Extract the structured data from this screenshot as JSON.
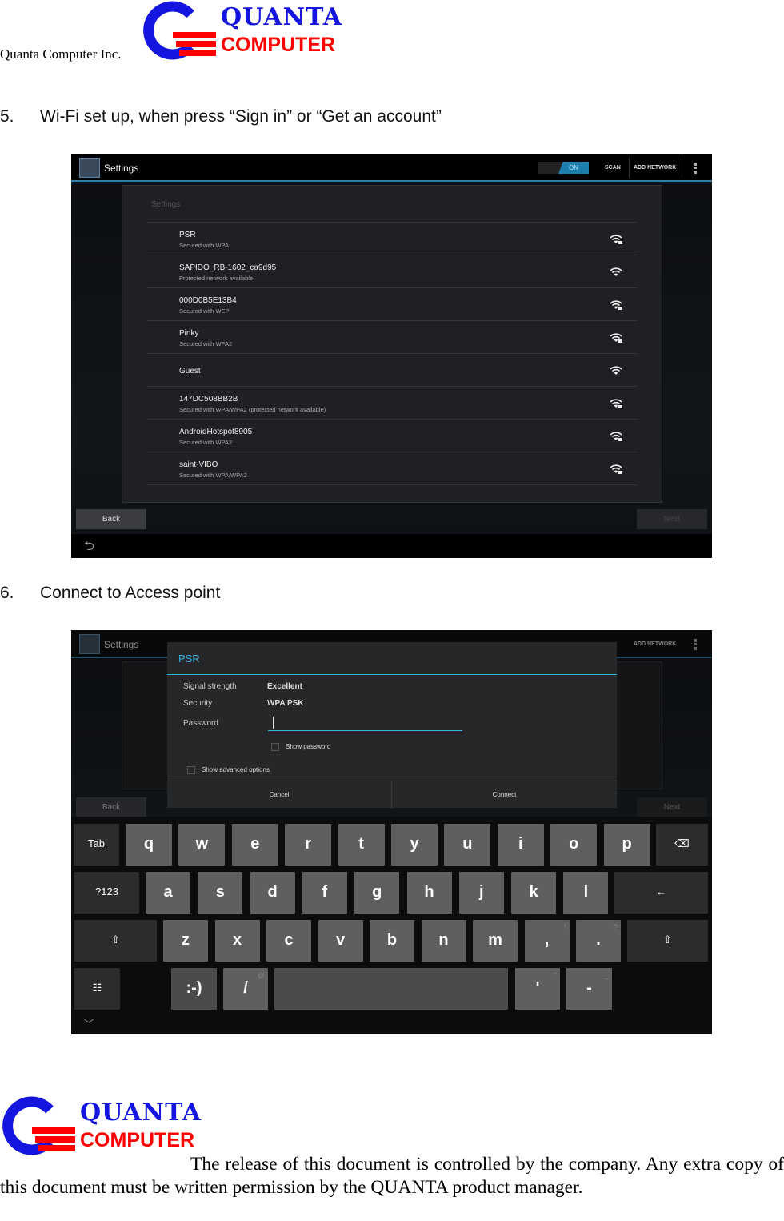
{
  "header": {
    "company": "Quanta Computer Inc.",
    "logo_line1": "QUANTA",
    "logo_line2": "COMPUTER"
  },
  "section5": {
    "number": "5.",
    "title": "Wi-Fi set up, when press “Sign in” or “Get an account”"
  },
  "section6": {
    "number": "6.",
    "title": "Connect to Access point"
  },
  "screen1": {
    "app_title": "Settings",
    "toggle": "ON",
    "scan": "SCAN",
    "add_network": "ADD NETWORK",
    "panel_header": "Settings",
    "networks": [
      {
        "name": "PSR",
        "status": "Secured with WPA",
        "locked": true
      },
      {
        "name": "SAPIDO_RB-1602_ca9d95",
        "status": "Protected network available",
        "locked": false
      },
      {
        "name": "000D0B5E13B4",
        "status": "Secured with WEP",
        "locked": true
      },
      {
        "name": "Pinky",
        "status": "Secured with WPA2",
        "locked": true
      },
      {
        "name": "Guest",
        "status": "",
        "locked": false
      },
      {
        "name": "147DC508BB2B",
        "status": "Secured with WPA/WPA2 (protected network available)",
        "locked": true
      },
      {
        "name": "AndroidHotspot8905",
        "status": "Secured with WPA2",
        "locked": true
      },
      {
        "name": "saint-VIBO",
        "status": "Secured with WPA/WPA2",
        "locked": true
      }
    ],
    "back": "Back",
    "next": "Next"
  },
  "screen2": {
    "app_title": "Settings",
    "add_network": "ADD NETWORK",
    "back": "Back",
    "next": "Next",
    "dialog": {
      "title": "PSR",
      "signal_label": "Signal strength",
      "signal_value": "Excellent",
      "security_label": "Security",
      "security_value": "WPA PSK",
      "password_label": "Password",
      "password_value": "",
      "show_password": "Show password",
      "show_advanced": "Show advanced options",
      "cancel": "Cancel",
      "connect": "Connect"
    },
    "keyboard": {
      "rows": [
        [
          {
            "k": "Tab",
            "fn": true
          },
          {
            "k": "q"
          },
          {
            "k": "w"
          },
          {
            "k": "e"
          },
          {
            "k": "r"
          },
          {
            "k": "t"
          },
          {
            "k": "y"
          },
          {
            "k": "u"
          },
          {
            "k": "i"
          },
          {
            "k": "o"
          },
          {
            "k": "p"
          },
          {
            "k": "⌫",
            "fn": true
          }
        ],
        [
          {
            "k": "?123",
            "fn": true
          },
          {
            "k": "a"
          },
          {
            "k": "s"
          },
          {
            "k": "d"
          },
          {
            "k": "f"
          },
          {
            "k": "g"
          },
          {
            "k": "h"
          },
          {
            "k": "j"
          },
          {
            "k": "k"
          },
          {
            "k": "l"
          },
          {
            "k": "←",
            "fn": true
          }
        ],
        [
          {
            "k": "⇧",
            "fn": true
          },
          {
            "k": "z"
          },
          {
            "k": "x"
          },
          {
            "k": "c"
          },
          {
            "k": "v"
          },
          {
            "k": "b"
          },
          {
            "k": "n"
          },
          {
            "k": "m"
          },
          {
            "k": ",",
            "hint": "!"
          },
          {
            "k": ".",
            "hint": "?"
          },
          {
            "k": "⇧",
            "fn": true
          }
        ],
        [
          {
            "k": "☷",
            "fn": true
          },
          {
            "k": ":-)",
            "sp": true
          },
          {
            "k": "/",
            "hint": "@"
          },
          {
            "k": "",
            "sp": true
          },
          {
            "k": "'",
            "hint": "\""
          },
          {
            "k": "-",
            "hint": "_"
          }
        ]
      ]
    }
  },
  "footer": {
    "text": "The release of this document is controlled by the company. Any extra copy of this document must be written permission by the QUANTA product manager."
  }
}
